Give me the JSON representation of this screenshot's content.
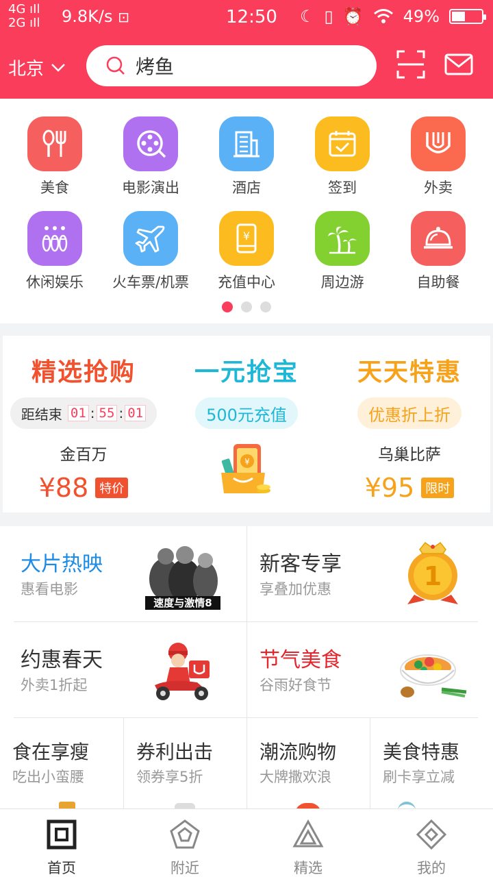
{
  "status": {
    "net1": "4G",
    "net2": "2G",
    "speed": "9.8K/s",
    "time": "12:50",
    "battery": "49%",
    "battery_level": 0.49
  },
  "header": {
    "city": "北京",
    "search_text": "烤鱼"
  },
  "categories": [
    {
      "label": "美食",
      "icon": "fork-knife-icon",
      "color": "#f5605e"
    },
    {
      "label": "电影演出",
      "icon": "film-reel-icon",
      "color": "#b071f0"
    },
    {
      "label": "酒店",
      "icon": "hotel-building-icon",
      "color": "#5ab1f5"
    },
    {
      "label": "签到",
      "icon": "calendar-check-icon",
      "color": "#fcbb1e"
    },
    {
      "label": "外卖",
      "icon": "takeout-bag-icon",
      "color": "#fb6a4f"
    },
    {
      "label": "休闲娱乐",
      "icon": "bowling-pins-icon",
      "color": "#b071f0"
    },
    {
      "label": "火车票/机票",
      "icon": "airplane-icon",
      "color": "#5ab1f5"
    },
    {
      "label": "充值中心",
      "icon": "phone-yuan-icon",
      "color": "#fcbb1e"
    },
    {
      "label": "周边游",
      "icon": "palm-tree-icon",
      "color": "#82d131"
    },
    {
      "label": "自助餐",
      "icon": "food-cloche-icon",
      "color": "#f5605e"
    }
  ],
  "promo": {
    "left": {
      "title": "精选抢购",
      "countdown_label": "距结束",
      "hh": "01",
      "mm": "55",
      "ss": "01",
      "sep": ":",
      "name": "金百万",
      "price": "¥88",
      "tag": "特价"
    },
    "mid": {
      "title": "一元抢宝",
      "pill": "500元充值"
    },
    "right": {
      "title": "天天特惠",
      "pill": "优惠折上折",
      "name": "乌巢比萨",
      "price": "¥95",
      "tag": "限时"
    }
  },
  "features": {
    "movie": {
      "title": "大片热映",
      "sub": "惠看电影",
      "poster_text": "速度与激情8"
    },
    "newuser": {
      "title": "新客专享",
      "sub": "享叠加优惠",
      "medal": "1"
    },
    "spring": {
      "title": "约惠春天",
      "sub": "外卖1折起"
    },
    "season": {
      "title": "节气美食",
      "sub": "谷雨好食节"
    },
    "slim": {
      "title": "食在享瘦",
      "sub": "吃出小蛮腰"
    },
    "coupon": {
      "title": "券利出击",
      "sub": "领券享5折"
    },
    "fashion": {
      "title": "潮流购物",
      "sub": "大牌撒欢浪"
    },
    "deal": {
      "title": "美食特惠",
      "sub": "刷卡享立减"
    }
  },
  "tabs": [
    {
      "label": "首页",
      "icon": "home-square-icon"
    },
    {
      "label": "附近",
      "icon": "nearby-pentagon-icon"
    },
    {
      "label": "精选",
      "icon": "featured-triangle-icon"
    },
    {
      "label": "我的",
      "icon": "profile-diamond-icon"
    }
  ],
  "colors": {
    "brand": "#fa3d5a",
    "promo_red": "#f0522f",
    "promo_cyan": "#1fb7d6",
    "promo_orange": "#f7a21b",
    "blue_title": "#1b8be6"
  }
}
